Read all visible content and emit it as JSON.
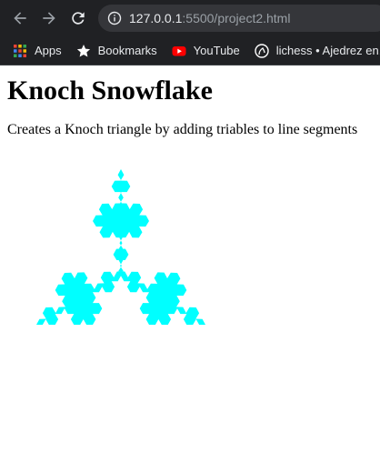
{
  "browser": {
    "url_host": "127.0.0.1",
    "url_rest": ":5500/project2.html"
  },
  "bookmarks": [
    {
      "label": "Apps",
      "icon": "apps-grid-icon"
    },
    {
      "label": "Bookmarks",
      "icon": "star-icon"
    },
    {
      "label": "YouTube",
      "icon": "youtube-icon"
    },
    {
      "label": "lichess • Ajedrez en...",
      "icon": "lichess-icon"
    }
  ],
  "page": {
    "title": "Knoch Snowflake",
    "description": "Creates a Knoch triangle by adding triables to line segments"
  },
  "snowflake": {
    "fill_color": "#00ffff",
    "iterations": 3
  },
  "colors": {
    "chrome_bg": "#202124",
    "omnibox_bg": "#35363a"
  }
}
